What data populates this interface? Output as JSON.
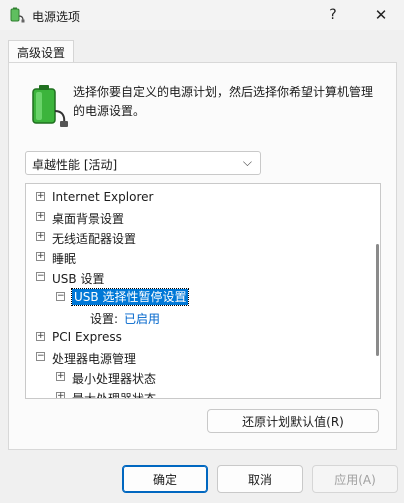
{
  "window": {
    "title": "电源选项",
    "help_label": "?",
    "close_label": "✕"
  },
  "tab": {
    "label": "高级设置"
  },
  "description": "选择你要自定义的电源计划，然后选择你希望计算机管理的电源设置。",
  "plan_select": {
    "value": "卓越性能 [活动]",
    "chevron": "⌵"
  },
  "tree": {
    "rows": [
      {
        "label": "Internet Explorer",
        "level": 0,
        "expander": "+"
      },
      {
        "label": "桌面背景设置",
        "level": 0,
        "expander": "+"
      },
      {
        "label": "无线适配器设置",
        "level": 0,
        "expander": "+"
      },
      {
        "label": "睡眠",
        "level": 0,
        "expander": "+"
      },
      {
        "label": "USB 设置",
        "level": 0,
        "expander": "−"
      },
      {
        "label": "USB 选择性暂停设置",
        "level": 1,
        "expander": "−",
        "selected": true
      },
      {
        "label": "设置:",
        "level": 2,
        "expander": "",
        "link": "已启用"
      },
      {
        "label": "PCI Express",
        "level": 0,
        "expander": "+"
      },
      {
        "label": "处理器电源管理",
        "level": 0,
        "expander": "−"
      },
      {
        "label": "最小处理器状态",
        "level": 1,
        "expander": "+"
      },
      {
        "label": "最大处理器状态",
        "level": 1,
        "expander": "+"
      }
    ]
  },
  "buttons": {
    "restore": "还原计划默认值(R)",
    "ok": "确定",
    "cancel": "取消",
    "apply": "应用(A)"
  },
  "colors": {
    "accent": "#0078d7",
    "link": "#0066cc",
    "battery_green": "#3cb43c"
  },
  "icons": {
    "title": "power-options-icon",
    "battery": "battery-plug-icon",
    "help": "help-icon",
    "close": "close-icon"
  }
}
